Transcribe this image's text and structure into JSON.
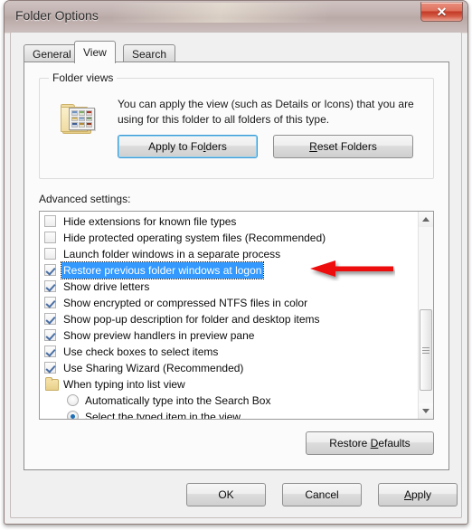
{
  "window": {
    "title": "Folder Options",
    "close_label": "×",
    "close_icon": "close-x-icon"
  },
  "tabs": [
    {
      "label": "General",
      "active": false
    },
    {
      "label": "View",
      "active": true
    },
    {
      "label": "Search",
      "active": false
    }
  ],
  "folder_views": {
    "legend": "Folder views",
    "description": "You can apply the view (such as Details or Icons) that you are using for this folder to all folders of this type.",
    "apply_button": {
      "pre": "Apply to Fo",
      "accel": "l",
      "post": "ders"
    },
    "reset_button": {
      "pre": "",
      "accel": "R",
      "post": "eset Folders"
    }
  },
  "advanced": {
    "label": "Advanced settings:",
    "items": [
      {
        "type": "checkbox",
        "checked": false,
        "label": "Hide extensions for known file types"
      },
      {
        "type": "checkbox",
        "checked": false,
        "label": "Hide protected operating system files (Recommended)"
      },
      {
        "type": "checkbox",
        "checked": false,
        "label": "Launch folder windows in a separate process"
      },
      {
        "type": "checkbox",
        "checked": true,
        "selected": true,
        "label": "Restore previous folder windows at logon"
      },
      {
        "type": "checkbox",
        "checked": true,
        "label": "Show drive letters"
      },
      {
        "type": "checkbox",
        "checked": true,
        "label": "Show encrypted or compressed NTFS files in color"
      },
      {
        "type": "checkbox",
        "checked": true,
        "label": "Show pop-up description for folder and desktop items"
      },
      {
        "type": "checkbox",
        "checked": true,
        "label": "Show preview handlers in preview pane"
      },
      {
        "type": "checkbox",
        "checked": true,
        "label": "Use check boxes to select items"
      },
      {
        "type": "checkbox",
        "checked": true,
        "label": "Use Sharing Wizard (Recommended)"
      },
      {
        "type": "folder",
        "label": "When typing into list view"
      },
      {
        "type": "radio",
        "checked": false,
        "label": "Automatically type into the Search Box"
      },
      {
        "type": "radio",
        "checked": true,
        "label": "Select the typed item in the view"
      }
    ],
    "restore_defaults_button": {
      "pre": "Restore ",
      "accel": "D",
      "post": "efaults"
    }
  },
  "footer": {
    "ok": "OK",
    "cancel": "Cancel",
    "apply": {
      "pre": "",
      "accel": "A",
      "post": "pply"
    }
  },
  "annotation": {
    "arrow_color": "#ee1111",
    "points_to": "Restore previous folder windows at logon"
  },
  "colors": {
    "selection_blue": "#3399ff",
    "close_red": "#c23a26",
    "focus_blue": "#3c9ad6",
    "dialog_bg": "#f0f0f0",
    "panel_bg": "#fbfbfb",
    "frame_border": "#8e7c79"
  }
}
